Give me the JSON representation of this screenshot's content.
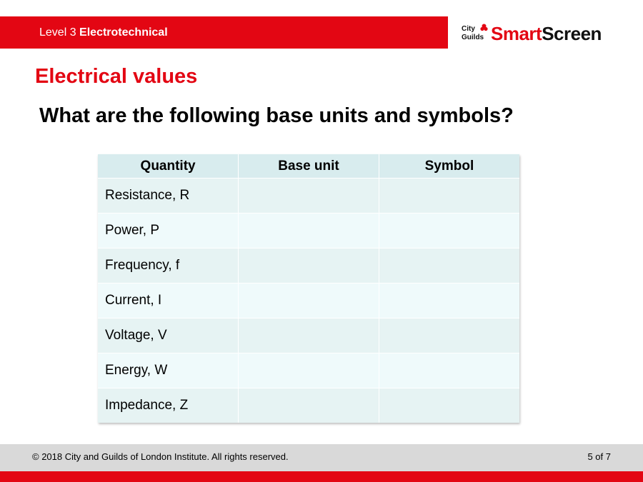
{
  "header": {
    "level": "Level 3",
    "course": "Electrotechnical",
    "logo": {
      "line1": "City",
      "line2": "Guilds",
      "mark": "&",
      "smart": "Smart",
      "screen": "Screen",
      "icon": "city-guilds-flower-icon"
    }
  },
  "slide": {
    "title": "Electrical values",
    "question": "What are the following base units and symbols?"
  },
  "table": {
    "columns": [
      "Quantity",
      "Base unit",
      "Symbol"
    ],
    "rows": [
      {
        "quantity": "Resistance, R",
        "base_unit": "",
        "symbol": ""
      },
      {
        "quantity": "Power, P",
        "base_unit": "",
        "symbol": ""
      },
      {
        "quantity": "Frequency, f",
        "base_unit": "",
        "symbol": ""
      },
      {
        "quantity": "Current, I",
        "base_unit": "",
        "symbol": ""
      },
      {
        "quantity": "Voltage, V",
        "base_unit": "",
        "symbol": ""
      },
      {
        "quantity": "Energy, W",
        "base_unit": "",
        "symbol": ""
      },
      {
        "quantity": "Impedance, Z",
        "base_unit": "",
        "symbol": ""
      }
    ]
  },
  "footer": {
    "copyright": "© 2018 City and Guilds of London Institute. All rights reserved.",
    "page": "5 of 7"
  },
  "colors": {
    "brand_red": "#e30613",
    "table_header": "#d8ecee",
    "footer_grey": "#d9d9d9"
  }
}
